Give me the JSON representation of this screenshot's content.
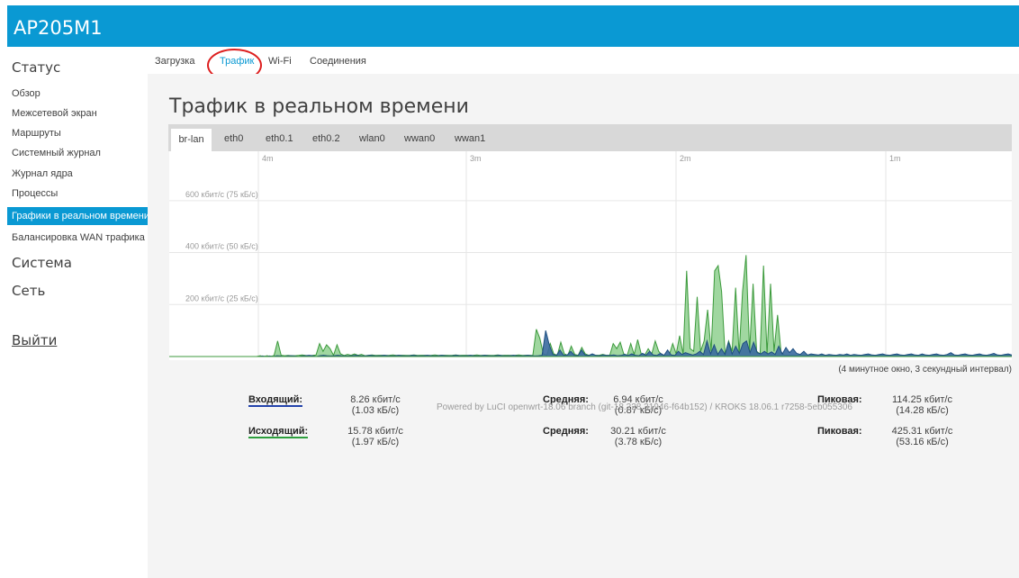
{
  "app": {
    "title": "AP205M1"
  },
  "sidebar": {
    "status_label": "Статус",
    "status_items": [
      {
        "label": "Обзор"
      },
      {
        "label": "Межсетевой экран"
      },
      {
        "label": "Маршруты"
      },
      {
        "label": "Системный журнал"
      },
      {
        "label": "Журнал ядра"
      },
      {
        "label": "Процессы"
      },
      {
        "label": "Графики в реальном времени"
      },
      {
        "label": "Балансировка WAN трафика"
      }
    ],
    "system_label": "Система",
    "network_label": "Сеть",
    "logout_label": "Выйти"
  },
  "tabs": [
    "Загрузка",
    "Трафик",
    "Wi-Fi",
    "Соединения"
  ],
  "active_tab": "Трафик",
  "main": {
    "title": "Трафик в реальном времени"
  },
  "interfaces": [
    "br-lan",
    "eth0",
    "eth0.1",
    "eth0.2",
    "wlan0",
    "wwan0",
    "wwan1"
  ],
  "active_interface": "br-lan",
  "chart_data": {
    "type": "area",
    "x_tick_labels": [
      "4m",
      "3m",
      "2m",
      "1m"
    ],
    "y_tick_labels": [
      "600 кбит/с (75 кБ/с)",
      "400 кбит/с (50 кБ/с)",
      "200 кбит/с (25 кБ/с)"
    ],
    "y_ticks": [
      600,
      400,
      200
    ],
    "ylim": [
      0,
      790
    ],
    "note": "(4 минутное окно, 3 секундный интервал)",
    "series": [
      {
        "name": "Входящий",
        "color": "#2c5ea0",
        "values": [
          0,
          0,
          0,
          0,
          0,
          0,
          0,
          0,
          0,
          0,
          0,
          0,
          0,
          0,
          0,
          0,
          0,
          0,
          0,
          0,
          0,
          0,
          0,
          0,
          0,
          0,
          2,
          0,
          2,
          0,
          3,
          2,
          0,
          2,
          3,
          2,
          0,
          2,
          3,
          5,
          3,
          0,
          3,
          5,
          3,
          2,
          3,
          5,
          3,
          2,
          2,
          3,
          5,
          3,
          2,
          3,
          5,
          3,
          2,
          3,
          5,
          3,
          2,
          3,
          5,
          3,
          2,
          3,
          5,
          3,
          2,
          3,
          5,
          3,
          2,
          3,
          5,
          3,
          2,
          3,
          5,
          3,
          2,
          3,
          5,
          3,
          2,
          3,
          5,
          3,
          2,
          3,
          5,
          3,
          2,
          3,
          5,
          3,
          2,
          3,
          5,
          3,
          2,
          3,
          5,
          100,
          45,
          8,
          4,
          25,
          5,
          6,
          20,
          5,
          3,
          25,
          6,
          4,
          10,
          4,
          3,
          6,
          4,
          4,
          6,
          3,
          4,
          8,
          4,
          10,
          5,
          3,
          12,
          5,
          20,
          6,
          4,
          12,
          5,
          25,
          6,
          4,
          20,
          8,
          15,
          10,
          6,
          10,
          20,
          8,
          60,
          10,
          45,
          8,
          30,
          8,
          55,
          10,
          40,
          12,
          50,
          60,
          15,
          55,
          15,
          10,
          20,
          10,
          18,
          8,
          40,
          10,
          35,
          15,
          30,
          12,
          8,
          20,
          6,
          10,
          8,
          6,
          10,
          5,
          8,
          6,
          5,
          8,
          6,
          10,
          5,
          8,
          6,
          5,
          8,
          10,
          6,
          5,
          8,
          10,
          6,
          5,
          8,
          10,
          6,
          5,
          8,
          10,
          6,
          5,
          10,
          6,
          5,
          8,
          10,
          6,
          5,
          8,
          15,
          6,
          5,
          8,
          10,
          6,
          5,
          8,
          10,
          6,
          5,
          8,
          12,
          6,
          5,
          8,
          10,
          6
        ]
      },
      {
        "name": "Исходящий",
        "color": "#6bbf6b",
        "values": [
          0,
          0,
          0,
          0,
          0,
          0,
          0,
          0,
          0,
          0,
          0,
          0,
          0,
          0,
          0,
          0,
          0,
          0,
          0,
          0,
          0,
          0,
          0,
          0,
          0,
          0,
          3,
          0,
          3,
          0,
          4,
          60,
          5,
          3,
          4,
          3,
          3,
          4,
          6,
          4,
          3,
          4,
          6,
          50,
          20,
          45,
          30,
          5,
          45,
          10,
          4,
          8,
          5,
          10,
          5,
          8,
          3,
          5,
          6,
          4,
          5,
          5,
          4,
          5,
          6,
          4,
          5,
          5,
          4,
          5,
          6,
          4,
          5,
          5,
          4,
          5,
          6,
          4,
          5,
          5,
          4,
          5,
          6,
          4,
          5,
          5,
          4,
          5,
          6,
          4,
          5,
          5,
          4,
          5,
          6,
          4,
          5,
          5,
          4,
          5,
          6,
          4,
          5,
          5,
          4,
          105,
          70,
          10,
          5,
          50,
          10,
          5,
          55,
          10,
          5,
          40,
          8,
          5,
          35,
          10,
          5,
          8,
          5,
          5,
          8,
          5,
          5,
          50,
          30,
          55,
          10,
          5,
          50,
          8,
          65,
          10,
          5,
          30,
          10,
          60,
          20,
          5,
          5,
          5,
          50,
          10,
          80,
          10,
          330,
          30,
          20,
          230,
          20,
          60,
          180,
          20,
          330,
          350,
          250,
          10,
          60,
          20,
          265,
          10,
          250,
          390,
          20,
          280,
          20,
          10,
          350,
          10,
          280,
          20,
          160,
          15,
          5,
          5,
          5,
          5,
          5,
          5,
          5,
          5,
          5,
          5,
          5,
          5,
          5,
          5,
          5,
          5,
          5,
          5,
          5,
          5,
          5,
          5,
          5,
          5,
          5,
          5,
          5,
          5,
          5,
          5,
          5,
          5,
          5,
          5,
          5,
          5,
          5,
          5,
          5,
          5,
          5,
          5,
          5,
          5,
          5,
          5,
          5,
          5,
          5,
          5,
          5,
          5,
          5,
          5,
          5,
          5,
          5,
          5,
          5,
          5,
          5,
          5,
          5,
          5,
          5,
          5
        ]
      }
    ]
  },
  "stats": {
    "inbound": {
      "label": "Входящий:",
      "current": "8.26 кбит/с",
      "current_kb": "(1.03 кБ/с)",
      "avg_label": "Средняя:",
      "avg": "6.94 кбит/с",
      "avg_kb": "(0.87 кБ/с)",
      "peak_label": "Пиковая:",
      "peak": "114.25 кбит/с",
      "peak_kb": "(14.28 кБ/с)"
    },
    "outbound": {
      "label": "Исходящий:",
      "current": "15.78 кбит/с",
      "current_kb": "(1.97 кБ/с)",
      "avg_label": "Средняя:",
      "avg": "30.21 кбит/с",
      "avg_kb": "(3.78 кБ/с)",
      "peak_label": "Пиковая:",
      "peak": "425.31 кбит/с",
      "peak_kb": "(53.16 кБ/с)"
    }
  },
  "footer": "Powered by LuCI openwrt-18.06 branch (git-18.228.31946-f64b152) / KROKS 18.06.1 r7258-5eb055306"
}
